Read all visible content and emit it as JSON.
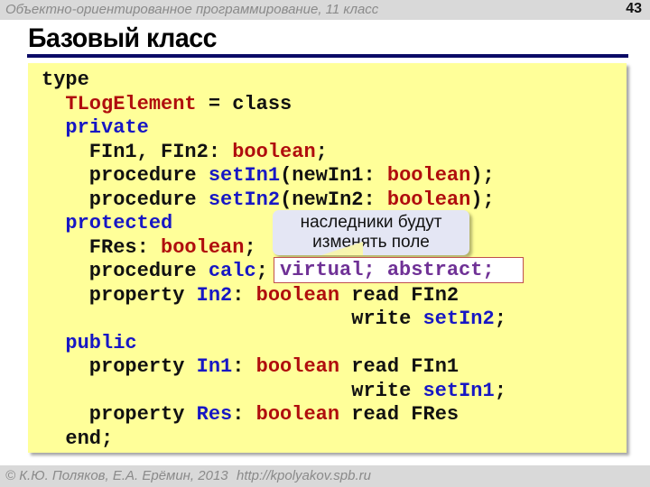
{
  "header": {
    "subject": "Объектно-ориентированное программирование, 11 класс",
    "page_number": "43"
  },
  "slide": {
    "title": "Базовый класс"
  },
  "code": {
    "lines": [
      [
        {
          "t": "type",
          "c": "kw"
        }
      ],
      [
        {
          "t": "  "
        },
        {
          "t": "TLogElement",
          "c": "type"
        },
        {
          "t": " = class",
          "c": "kw"
        }
      ],
      [
        {
          "t": "  "
        },
        {
          "t": "private",
          "c": "sec"
        }
      ],
      [
        {
          "t": "    FIn1, FIn2: ",
          "c": "kw"
        },
        {
          "t": "boolean",
          "c": "type"
        },
        {
          "t": ";",
          "c": "kw"
        }
      ],
      [
        {
          "t": "    procedure ",
          "c": "kw"
        },
        {
          "t": "setIn1",
          "c": "id"
        },
        {
          "t": "(newIn1: ",
          "c": "kw"
        },
        {
          "t": "boolean",
          "c": "type"
        },
        {
          "t": ");",
          "c": "kw"
        }
      ],
      [
        {
          "t": "    procedure ",
          "c": "kw"
        },
        {
          "t": "setIn2",
          "c": "id"
        },
        {
          "t": "(newIn2: ",
          "c": "kw"
        },
        {
          "t": "boolean",
          "c": "type"
        },
        {
          "t": ");",
          "c": "kw"
        }
      ],
      [
        {
          "t": "  "
        },
        {
          "t": "protected",
          "c": "sec"
        }
      ],
      [
        {
          "t": "    FRes: ",
          "c": "kw"
        },
        {
          "t": "boolean",
          "c": "type"
        },
        {
          "t": ";",
          "c": "kw"
        }
      ],
      [
        {
          "t": "    procedure ",
          "c": "kw"
        },
        {
          "t": "calc",
          "c": "id"
        },
        {
          "t": ";",
          "c": "kw"
        }
      ],
      [
        {
          "t": "    property ",
          "c": "kw"
        },
        {
          "t": "In2",
          "c": "id"
        },
        {
          "t": ": ",
          "c": "kw"
        },
        {
          "t": "boolean",
          "c": "type"
        },
        {
          "t": " read FIn2",
          "c": "kw"
        }
      ],
      [
        {
          "t": "                          write ",
          "c": "kw"
        },
        {
          "t": "setIn2",
          "c": "id"
        },
        {
          "t": ";",
          "c": "kw"
        }
      ],
      [
        {
          "t": "  "
        },
        {
          "t": "public",
          "c": "sec"
        }
      ],
      [
        {
          "t": "    property ",
          "c": "kw"
        },
        {
          "t": "In1",
          "c": "id"
        },
        {
          "t": ": ",
          "c": "kw"
        },
        {
          "t": "boolean",
          "c": "type"
        },
        {
          "t": " read FIn1",
          "c": "kw"
        }
      ],
      [
        {
          "t": "                          write ",
          "c": "kw"
        },
        {
          "t": "setIn1",
          "c": "id"
        },
        {
          "t": ";",
          "c": "kw"
        }
      ],
      [
        {
          "t": "    property ",
          "c": "kw"
        },
        {
          "t": "Res",
          "c": "id"
        },
        {
          "t": ": ",
          "c": "kw"
        },
        {
          "t": "boolean",
          "c": "type"
        },
        {
          "t": " read FRes",
          "c": "kw"
        }
      ],
      [
        {
          "t": "  end;",
          "c": "kw"
        }
      ]
    ],
    "highlight_box_text": "virtual; abstract;"
  },
  "callout": {
    "lines": [
      "наследники будут",
      "изменять поле"
    ]
  },
  "footer": {
    "copyright": "© К.Ю. Поляков, Е.А. Ерёмин, 2013",
    "url": "http://kpolyakov.spb.ru"
  },
  "colors": {
    "code_background": "#ffff99",
    "keyword": "#111111",
    "type_name": "#b00d0d",
    "identifier": "#1717c4",
    "section": "#1717c4",
    "virtual_text": "#6f3196",
    "highlight_border": "#c0504d",
    "title_rule": "#0b0b66",
    "callout_background": "#e4e6f4"
  }
}
